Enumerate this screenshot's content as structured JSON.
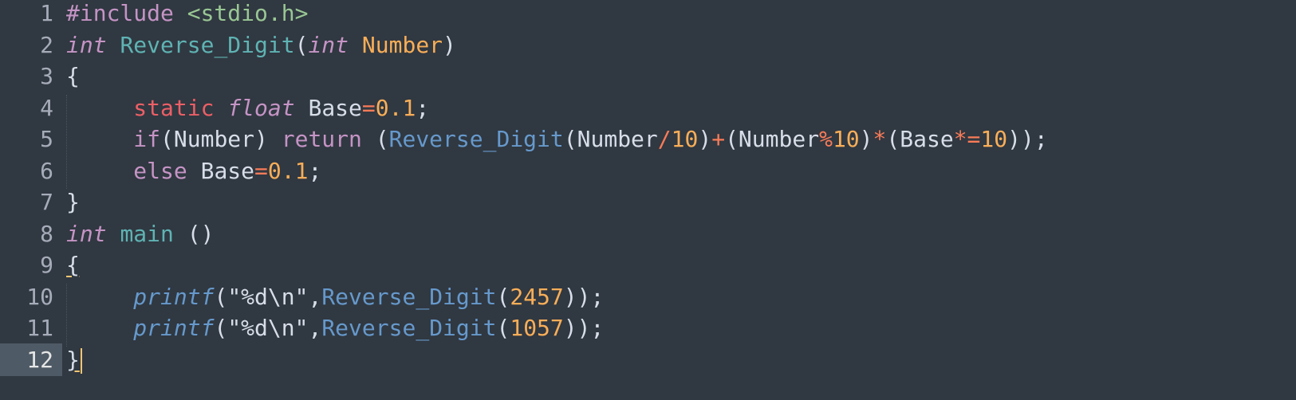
{
  "editor": {
    "lines": [
      {
        "number": "1",
        "tokens": [
          {
            "t": "#include",
            "c": "preproc"
          },
          {
            "t": " ",
            "c": "plain"
          },
          {
            "t": "<stdio.h>",
            "c": "string"
          }
        ]
      },
      {
        "number": "2",
        "tokens": [
          {
            "t": "int",
            "c": "type_italic"
          },
          {
            "t": " ",
            "c": "plain"
          },
          {
            "t": "Reverse_Digit",
            "c": "func_def"
          },
          {
            "t": "(",
            "c": "plain"
          },
          {
            "t": "int",
            "c": "type_italic"
          },
          {
            "t": " ",
            "c": "plain"
          },
          {
            "t": "Number",
            "c": "param"
          },
          {
            "t": ")",
            "c": "plain"
          }
        ]
      },
      {
        "number": "3",
        "tokens": [
          {
            "t": "{",
            "c": "plain"
          }
        ]
      },
      {
        "number": "4",
        "tokens": [
          {
            "t": "     ",
            "c": "plain"
          },
          {
            "t": "static",
            "c": "storage"
          },
          {
            "t": " ",
            "c": "plain"
          },
          {
            "t": "float",
            "c": "type_italic"
          },
          {
            "t": " ",
            "c": "plain"
          },
          {
            "t": "Base",
            "c": "plain"
          },
          {
            "t": "=",
            "c": "operator"
          },
          {
            "t": "0.1",
            "c": "number"
          },
          {
            "t": ";",
            "c": "plain"
          }
        ]
      },
      {
        "number": "5",
        "tokens": [
          {
            "t": "     ",
            "c": "plain"
          },
          {
            "t": "if",
            "c": "keyword"
          },
          {
            "t": "(Number) ",
            "c": "plain"
          },
          {
            "t": "return",
            "c": "keyword"
          },
          {
            "t": " (",
            "c": "plain"
          },
          {
            "t": "Reverse_Digit",
            "c": "func_call"
          },
          {
            "t": "(Number",
            "c": "plain"
          },
          {
            "t": "/",
            "c": "operator"
          },
          {
            "t": "10",
            "c": "number"
          },
          {
            "t": ")",
            "c": "plain"
          },
          {
            "t": "+",
            "c": "operator"
          },
          {
            "t": "(Number",
            "c": "plain"
          },
          {
            "t": "%",
            "c": "operator"
          },
          {
            "t": "10",
            "c": "number"
          },
          {
            "t": ")",
            "c": "plain"
          },
          {
            "t": "*",
            "c": "operator"
          },
          {
            "t": "(Base",
            "c": "plain"
          },
          {
            "t": "*=",
            "c": "operator"
          },
          {
            "t": "10",
            "c": "number"
          },
          {
            "t": "));",
            "c": "plain"
          }
        ]
      },
      {
        "number": "6",
        "tokens": [
          {
            "t": "     ",
            "c": "plain"
          },
          {
            "t": "else",
            "c": "keyword"
          },
          {
            "t": " Base",
            "c": "plain"
          },
          {
            "t": "=",
            "c": "operator"
          },
          {
            "t": "0.1",
            "c": "number"
          },
          {
            "t": ";",
            "c": "plain"
          }
        ]
      },
      {
        "number": "7",
        "tokens": [
          {
            "t": "}",
            "c": "plain"
          }
        ]
      },
      {
        "number": "8",
        "tokens": [
          {
            "t": "int",
            "c": "type_italic"
          },
          {
            "t": " ",
            "c": "plain"
          },
          {
            "t": "main",
            "c": "func_def"
          },
          {
            "t": " ()",
            "c": "plain"
          }
        ]
      },
      {
        "number": "9",
        "tokens": [
          {
            "t": "{",
            "c": "bracket_match"
          }
        ]
      },
      {
        "number": "10",
        "tokens": [
          {
            "t": "     ",
            "c": "plain"
          },
          {
            "t": "printf",
            "c": "func_call_italic"
          },
          {
            "t": "(",
            "c": "plain"
          },
          {
            "t": "\"%d\\n\"",
            "c": "plain"
          },
          {
            "t": ",",
            "c": "plain"
          },
          {
            "t": "Reverse_Digit",
            "c": "func_call"
          },
          {
            "t": "(",
            "c": "plain"
          },
          {
            "t": "2457",
            "c": "number"
          },
          {
            "t": "));",
            "c": "plain"
          }
        ]
      },
      {
        "number": "11",
        "tokens": [
          {
            "t": "     ",
            "c": "plain"
          },
          {
            "t": "printf",
            "c": "func_call_italic"
          },
          {
            "t": "(",
            "c": "plain"
          },
          {
            "t": "\"%d\\n\"",
            "c": "plain"
          },
          {
            "t": ",",
            "c": "plain"
          },
          {
            "t": "Reverse_Digit",
            "c": "func_call"
          },
          {
            "t": "(",
            "c": "plain"
          },
          {
            "t": "1057",
            "c": "number"
          },
          {
            "t": "));",
            "c": "plain"
          }
        ]
      },
      {
        "number": "12",
        "active": true,
        "tokens": [
          {
            "t": "}",
            "c": "bracket_match"
          }
        ]
      }
    ]
  },
  "colors": {
    "background": "#303841",
    "active_gutter": "#4e5a65",
    "gutter_text": "#a6acb9",
    "plain": "#d8dee9",
    "preproc": "#c594c5",
    "string": "#99c794",
    "type_italic": "#c594c5",
    "func_def": "#5fb3b3",
    "param": "#f9ae58",
    "storage": "#ec5f66",
    "operator": "#f97b58",
    "number": "#f9ae58",
    "keyword": "#c594c5",
    "func_call": "#6699cc",
    "func_call_italic": "#6699cc",
    "bracket_match": "#d8dee9",
    "cursor": "#f0c674"
  }
}
